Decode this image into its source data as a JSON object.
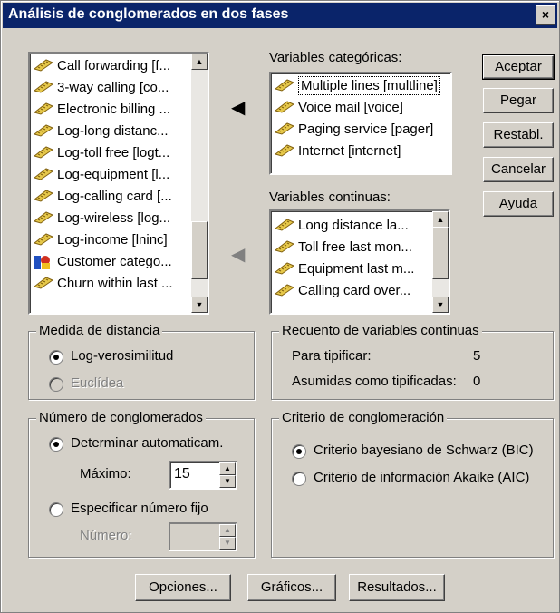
{
  "window": {
    "title": "Análisis de conglomerados en dos fases",
    "close": "×"
  },
  "source_list": {
    "items": [
      {
        "label": "Call forwarding [f...",
        "icon": "scale-ruler-icon"
      },
      {
        "label": "3-way calling [co...",
        "icon": "scale-ruler-icon"
      },
      {
        "label": "Electronic billing ...",
        "icon": "scale-ruler-icon"
      },
      {
        "label": "Log-long distanc...",
        "icon": "scale-ruler-icon"
      },
      {
        "label": "Log-toll free [logt...",
        "icon": "scale-ruler-icon"
      },
      {
        "label": "Log-equipment [l...",
        "icon": "scale-ruler-icon"
      },
      {
        "label": "Log-calling card [...",
        "icon": "scale-ruler-icon"
      },
      {
        "label": "Log-wireless [log...",
        "icon": "scale-ruler-icon"
      },
      {
        "label": "Log-income [lninc]",
        "icon": "scale-ruler-icon"
      },
      {
        "label": "Customer catego...",
        "icon": "nominal-icon"
      },
      {
        "label": "Churn within last ...",
        "icon": "scale-ruler-icon"
      }
    ]
  },
  "categorical": {
    "title": "Variables categóricas:",
    "items": [
      {
        "label": "Multiple lines [multline]",
        "selected": true
      },
      {
        "label": "Voice mail [voice]"
      },
      {
        "label": "Paging service [pager]"
      },
      {
        "label": "Internet [internet]"
      }
    ]
  },
  "continuous": {
    "title": "Variables continuas:",
    "items": [
      {
        "label": "Long distance la..."
      },
      {
        "label": "Toll free last mon..."
      },
      {
        "label": "Equipment last m..."
      },
      {
        "label": "Calling card over..."
      }
    ]
  },
  "buttons": {
    "accept": "Aceptar",
    "paste": "Pegar",
    "reset": "Restabl.",
    "cancel": "Cancelar",
    "help": "Ayuda"
  },
  "distance": {
    "title": "Medida de distancia",
    "loglik": "Log-verosimilitud",
    "euclid": "Euclídea"
  },
  "count": {
    "title": "Recuento de variables continuas",
    "standardize_label": "Para tipificar:",
    "standardize_value": "5",
    "assumed_label": "Asumidas como tipificadas:",
    "assumed_value": "0"
  },
  "clusters": {
    "title": "Número de conglomerados",
    "auto": "Determinar automaticam.",
    "max_label": "Máximo:",
    "max_value": "15",
    "fixed": "Especificar número fijo",
    "num_label": "Número:"
  },
  "criterion": {
    "title": "Criterio de conglomeración",
    "bic": "Criterio bayesiano de Schwarz (BIC)",
    "aic": "Criterio de información Akaike (AIC)"
  },
  "bottom": {
    "options": "Opciones...",
    "plots": "Gráficos...",
    "output": "Resultados..."
  }
}
